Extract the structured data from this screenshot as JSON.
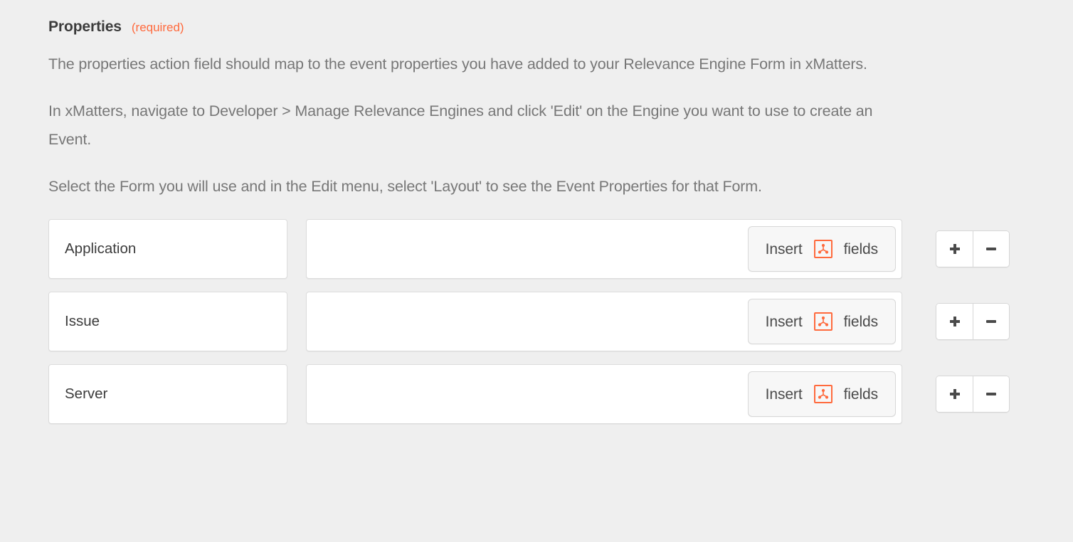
{
  "section": {
    "title": "Properties",
    "required_label": "(required)"
  },
  "description": {
    "paragraph1": "The properties action field should map to the event properties you have added to your Relevance Engine Form in xMatters.",
    "paragraph2": "In xMatters, navigate to Developer > Manage Relevance Engines and click 'Edit' on the Engine you want to use to create an Event.",
    "paragraph3": "Select the Form you will use and in the Edit menu, select 'Layout' to see the Event Properties for that Form."
  },
  "buttons": {
    "insert_prefix": "Insert",
    "insert_suffix": "fields",
    "insert_icon": "zapier-fields-icon",
    "add_icon": "plus-icon",
    "remove_icon": "minus-icon"
  },
  "colors": {
    "accent": "#ff6a3d",
    "background": "#efefef",
    "field_background": "#ffffff",
    "field_border": "#dcdcdc",
    "heading_text": "#3c3c3c",
    "body_text": "#777777"
  },
  "rows": [
    {
      "key": "Application",
      "value": "",
      "placeholder": ""
    },
    {
      "key": "Issue",
      "value": "",
      "placeholder": ""
    },
    {
      "key": "Server",
      "value": "",
      "placeholder": ""
    }
  ]
}
